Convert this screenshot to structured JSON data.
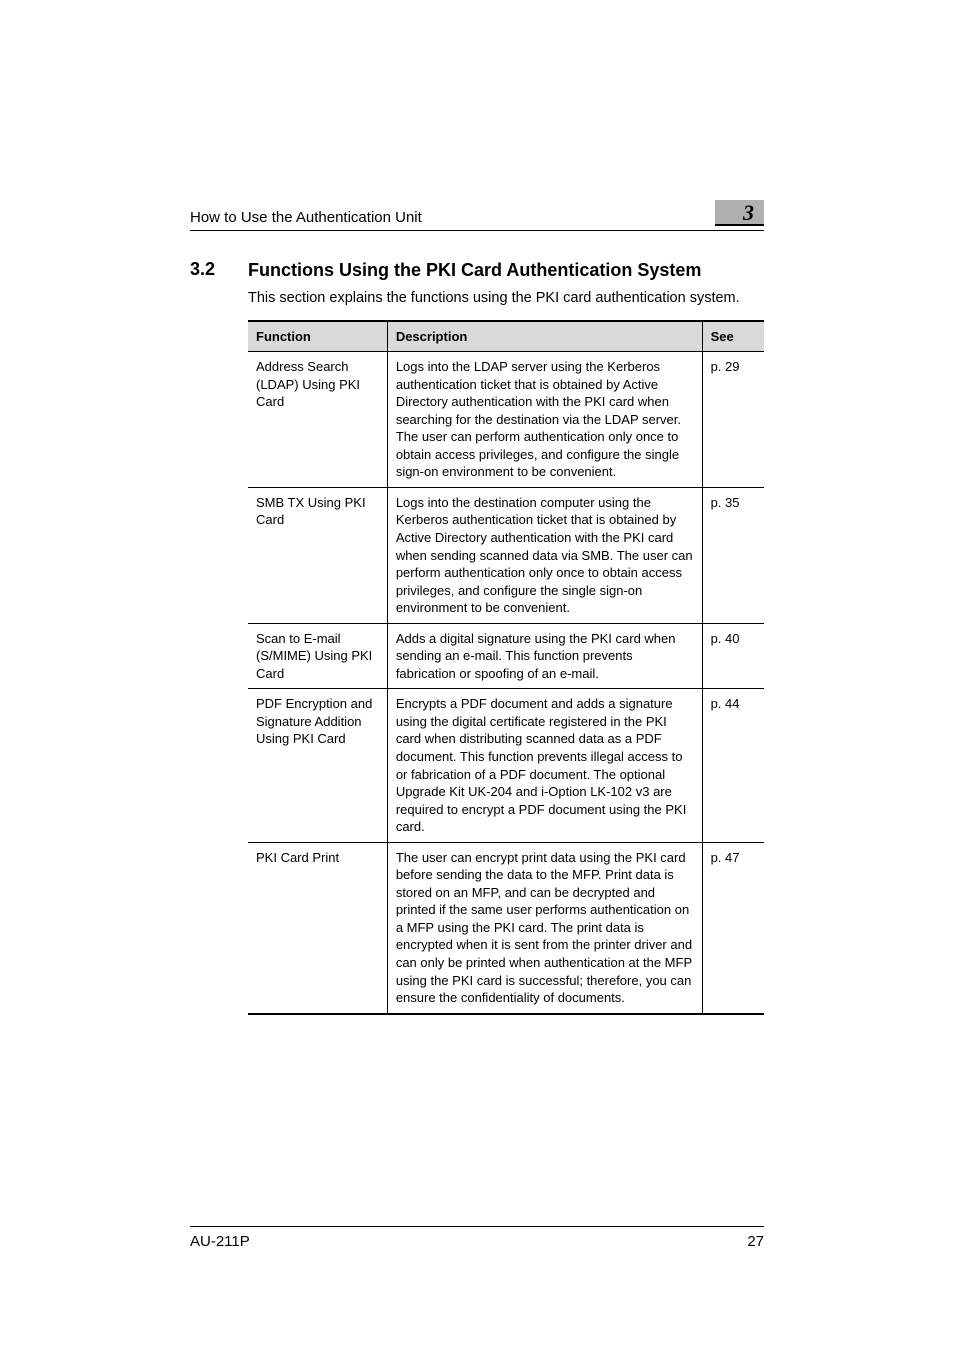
{
  "header": {
    "breadcrumb": "How to Use the Authentication Unit",
    "chapter": "3"
  },
  "section": {
    "number": "3.2",
    "title": "Functions Using the PKI Card Authentication System",
    "intro": "This section explains the functions using the PKI card authentication system."
  },
  "table": {
    "headers": {
      "c1": "Function",
      "c2": "Description",
      "c3": "See"
    },
    "rows": [
      {
        "func": "Address Search (LDAP) Using PKI Card",
        "desc": "Logs into the LDAP server using the Kerberos authentication ticket that is obtained by Active Directory authentication with the PKI card when searching for the destination via the LDAP server. The user can perform authentication only once to obtain access privileges, and configure the single sign-on environment to be convenient.",
        "see": "p. 29"
      },
      {
        "func": "SMB TX Using PKI Card",
        "desc": "Logs into the destination computer using the Kerberos authentication ticket that is obtained by Active Directory authentication with the PKI card when sending scanned data via SMB.\nThe user can perform authentication only once to obtain access privileges, and configure the single sign-on environment to be convenient.",
        "see": "p. 35"
      },
      {
        "func": "Scan to E-mail (S/MIME) Using PKI Card",
        "desc": "Adds a digital signature using the PKI card when sending an e-mail.\nThis function prevents fabrication or spoofing of an e-mail.",
        "see": "p. 40"
      },
      {
        "func": "PDF Encryption and Signature Addition Using PKI Card",
        "desc": "Encrypts a PDF document and adds a signature using the digital certificate registered in the PKI card when distributing scanned data as a PDF document.\nThis function prevents illegal access to or fabrication of a PDF document.\nThe optional Upgrade Kit UK-204 and i-Option LK-102 v3 are required to encrypt a PDF document using the PKI card.",
        "see": "p. 44"
      },
      {
        "func": "PKI Card Print",
        "desc": "The user can encrypt print data using the PKI card before sending the data to the MFP. Print data is stored on an MFP, and can be decrypted and printed if the same user performs authentication on a MFP using the PKI card.\nThe print data is encrypted when it is sent from the printer driver and can only be printed when authentication at the MFP using the PKI card is successful; therefore, you can ensure the confidentiality of documents.",
        "see": "p. 47"
      }
    ]
  },
  "footer": {
    "model": "AU-211P",
    "page": "27"
  }
}
